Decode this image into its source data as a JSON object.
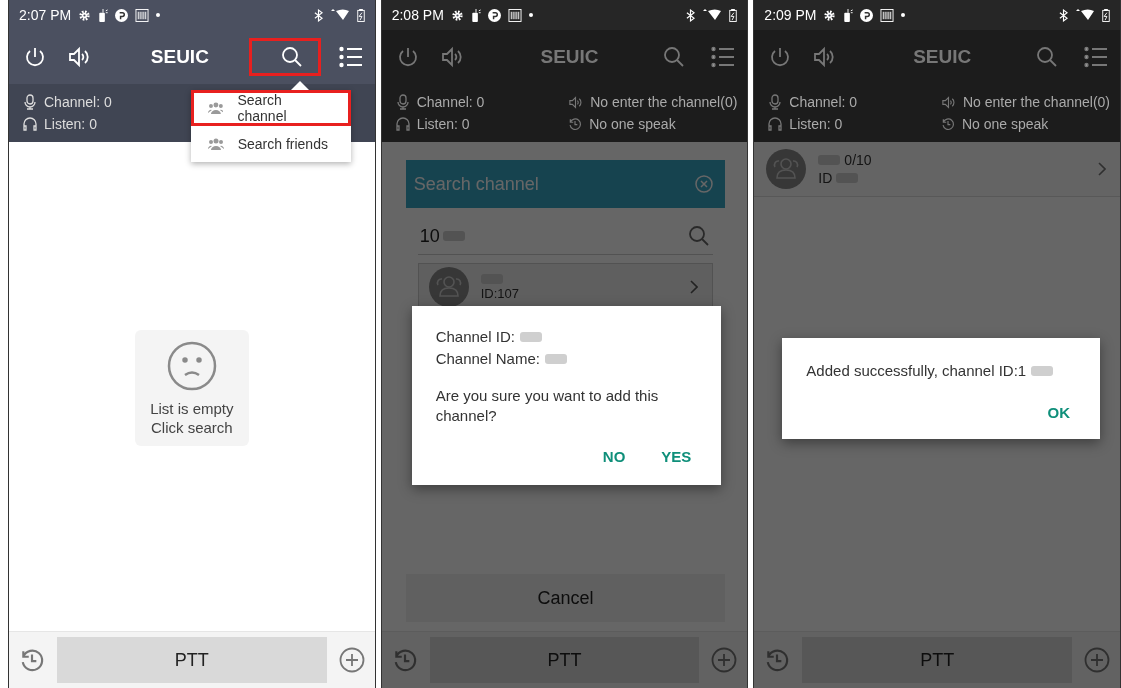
{
  "panels": [
    {
      "status_bar": {
        "time": "2:07 PM"
      },
      "header": {
        "title": "SEUIC",
        "search_highlighted": true
      },
      "info": {
        "channel": "Channel: 0",
        "listen": "Listen: 0"
      },
      "dimmed": false,
      "content": {
        "kind": "empty",
        "lines": [
          "List is empty",
          "Click search"
        ]
      },
      "menu": {
        "items": [
          {
            "label": "Search channel",
            "highlighted": true
          },
          {
            "label": "Search friends",
            "highlighted": false
          }
        ]
      },
      "bottom": {
        "ptt": "PTT"
      }
    },
    {
      "status_bar": {
        "time": "2:08 PM"
      },
      "header": {
        "title": "SEUIC",
        "search_highlighted": false
      },
      "info": {
        "channel": "Channel: 0",
        "listen": "Listen: 0",
        "entered": "No enter the channel(0)",
        "speaker": "No one speak"
      },
      "dimmed": true,
      "content": {
        "kind": "blank"
      },
      "search_dialog": {
        "title": "Search channel",
        "value": "10",
        "results": [
          {
            "id_text": "ID:107"
          }
        ],
        "cancel": "Cancel"
      },
      "dialog": {
        "kind": "confirm",
        "lines": [
          "Channel ID:",
          "Channel Name:"
        ],
        "message": "Are you sure you want to add this channel?",
        "buttons": [
          "NO",
          "YES"
        ]
      },
      "bottom": {
        "ptt": "PTT"
      }
    },
    {
      "status_bar": {
        "time": "2:09 PM"
      },
      "header": {
        "title": "SEUIC",
        "search_highlighted": false
      },
      "info": {
        "channel": "Channel: 0",
        "listen": "Listen: 0",
        "entered": "No enter the channel(0)",
        "speaker": "No one speak"
      },
      "dimmed": true,
      "content": {
        "kind": "list",
        "items": [
          {
            "count": "0/10",
            "id_text": "ID"
          }
        ]
      },
      "dialog": {
        "kind": "notice",
        "message": "Added successfully, channel ID:1",
        "buttons": [
          "OK"
        ]
      },
      "bottom": {
        "ptt": "PTT"
      }
    }
  ]
}
